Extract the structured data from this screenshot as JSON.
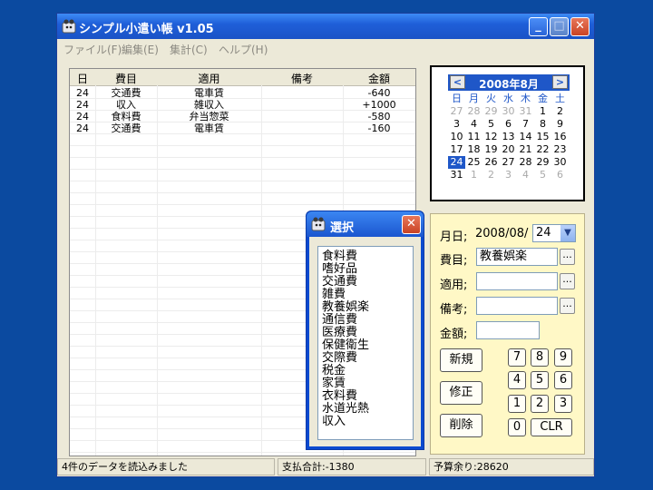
{
  "window": {
    "title": "シンプル小遣い帳 v1.05"
  },
  "menu": [
    "ファイル(F)",
    "編集(E)",
    "集計(C)",
    "ヘルプ(H)"
  ],
  "list": {
    "columns": [
      "日",
      "費目",
      "適用",
      "備考",
      "金額"
    ],
    "rows": [
      {
        "day": "24",
        "category": "交通費",
        "desc": "電車賃",
        "note": "",
        "amount": "-640"
      },
      {
        "day": "24",
        "category": "収入",
        "desc": "雑収入",
        "note": "",
        "amount": "+1000"
      },
      {
        "day": "24",
        "category": "食料費",
        "desc": "弁当惣菜",
        "note": "",
        "amount": "-580"
      },
      {
        "day": "24",
        "category": "交通費",
        "desc": "電車賃",
        "note": "",
        "amount": "-160"
      }
    ]
  },
  "calendar": {
    "title": "2008年8月",
    "prev": "<",
    "next": ">",
    "weekdays": [
      "日",
      "月",
      "火",
      "水",
      "木",
      "金",
      "土"
    ],
    "days": [
      [
        "27",
        "28",
        "29",
        "30",
        "31",
        "1",
        "2"
      ],
      [
        "3",
        "4",
        "5",
        "6",
        "7",
        "8",
        "9"
      ],
      [
        "10",
        "11",
        "12",
        "13",
        "14",
        "15",
        "16"
      ],
      [
        "17",
        "18",
        "19",
        "20",
        "21",
        "22",
        "23"
      ],
      [
        "24",
        "25",
        "26",
        "27",
        "28",
        "29",
        "30"
      ],
      [
        "31",
        "1",
        "2",
        "3",
        "4",
        "5",
        "6"
      ]
    ],
    "selected": "24"
  },
  "entry": {
    "date_label": "月日;",
    "date_prefix": "2008/08/",
    "day_value": "24",
    "category_label": "費目;",
    "category_value": "教養娯楽",
    "desc_label": "適用;",
    "desc_value": "",
    "note_label": "備考;",
    "note_value": "",
    "amount_label": "金額;",
    "amount_value": "",
    "dots": "...",
    "new_button": "新規",
    "edit_button": "修正",
    "delete_button": "削除",
    "keys": [
      "7",
      "8",
      "9",
      "4",
      "5",
      "6",
      "1",
      "2",
      "3",
      "0",
      "CLR"
    ]
  },
  "status": {
    "message": "4件のデータを読込みました",
    "total": "支払合計:-1380",
    "budget": "予算余り:28620"
  },
  "dialog": {
    "title": "選択",
    "items": [
      "食料費",
      "嗜好品",
      "交通費",
      "雑費",
      "教養娯楽",
      "通信費",
      "医療費",
      "保健衛生",
      "交際費",
      "税金",
      "家賃",
      "衣料費",
      "水道光熱",
      "収入"
    ]
  },
  "colors": {
    "accent": "#1f57c8",
    "desktop": "#0b4aa0",
    "panel": "#fff8c6"
  }
}
